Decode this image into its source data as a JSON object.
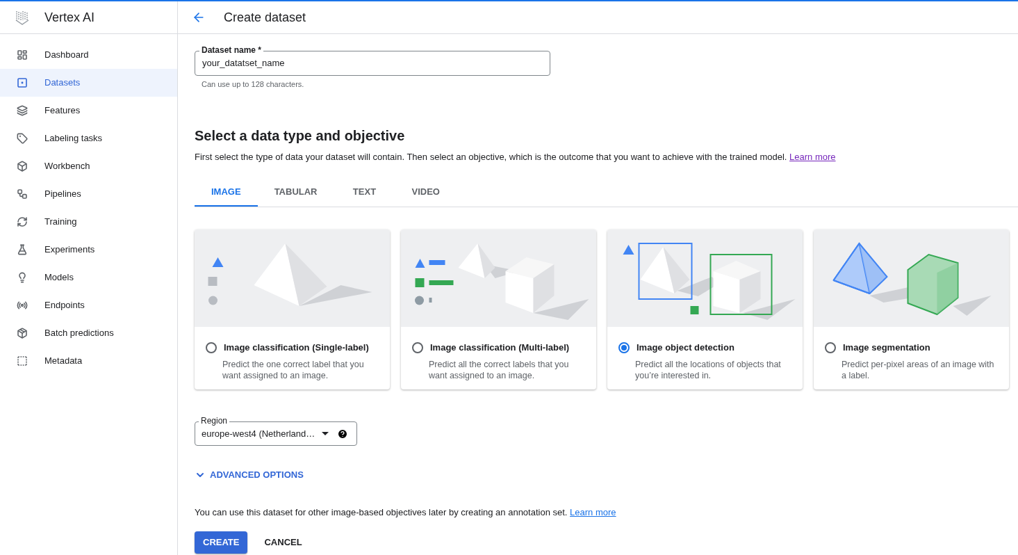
{
  "app": {
    "name": "Vertex AI"
  },
  "sidebar": {
    "items": [
      {
        "label": "Dashboard",
        "selected": false
      },
      {
        "label": "Datasets",
        "selected": true
      },
      {
        "label": "Features",
        "selected": false
      },
      {
        "label": "Labeling tasks",
        "selected": false
      },
      {
        "label": "Workbench",
        "selected": false
      },
      {
        "label": "Pipelines",
        "selected": false
      },
      {
        "label": "Training",
        "selected": false
      },
      {
        "label": "Experiments",
        "selected": false
      },
      {
        "label": "Models",
        "selected": false
      },
      {
        "label": "Endpoints",
        "selected": false
      },
      {
        "label": "Batch predictions",
        "selected": false
      },
      {
        "label": "Metadata",
        "selected": false
      }
    ]
  },
  "page": {
    "title": "Create dataset"
  },
  "name_field": {
    "label": "Dataset name *",
    "value": "your_datatset_name",
    "hint": "Can use up to 128 characters."
  },
  "section": {
    "title": "Select a data type and objective",
    "description": "First select the type of data your dataset will contain. Then select an objective, which is the outcome that you want to achieve with the trained model.",
    "link": "Learn more"
  },
  "tabs": [
    {
      "label": "IMAGE",
      "selected": true
    },
    {
      "label": "TABULAR",
      "selected": false
    },
    {
      "label": "TEXT",
      "selected": false
    },
    {
      "label": "VIDEO",
      "selected": false
    }
  ],
  "objectives": [
    {
      "kind": "single",
      "title": "Image classification (Single-label)",
      "description": "Predict the one correct label that you want assigned to an image.",
      "selected": false
    },
    {
      "kind": "multi",
      "title": "Image classification (Multi-label)",
      "description": "Predict all the correct labels that you want assigned to an image.",
      "selected": false
    },
    {
      "kind": "detection",
      "title": "Image object detection",
      "description": "Predict all the locations of objects that you’re interested in.",
      "selected": true
    },
    {
      "kind": "segmentation",
      "title": "Image segmentation",
      "description": "Predict per-pixel areas of an image with a label.",
      "selected": false
    }
  ],
  "region": {
    "label": "Region",
    "value": "europe-west4 (Netherland…"
  },
  "advanced": {
    "label": "ADVANCED OPTIONS",
    "expanded": false
  },
  "note": {
    "text": "You can use this dataset for other image-based objectives later by creating an annotation set.",
    "link": "Learn more"
  },
  "buttons": [
    {
      "kind": "primary",
      "label": "CREATE"
    },
    {
      "kind": "text",
      "label": "CANCEL"
    }
  ]
}
